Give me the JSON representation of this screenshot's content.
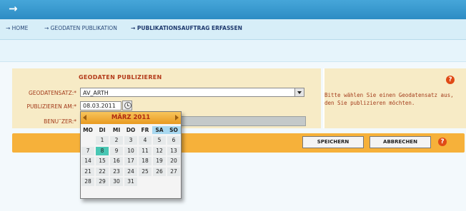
{
  "breadcrumb": [
    {
      "label": "HOME"
    },
    {
      "label": "GEODATEN PUBLIKATION"
    },
    {
      "label": "PUBLIKATIONSAUFTRAG ERFASSEN"
    }
  ],
  "form": {
    "title": "GEODATEN PUBLIZIEREN",
    "geodatensatz_label": "GEODATENSATZ:*",
    "geodatensatz_value": "AV_ARTH",
    "publish_date_label": "PUBLIZIEREN AM:*",
    "publish_date_value": "08.03.2011",
    "user_label": "BENU¯ZER:*",
    "user_value": ""
  },
  "hint": {
    "text": "Bitte wählen Sie einen Geodatensatz aus, den Sie publizieren möchten."
  },
  "actions": {
    "save_label": "SPEICHERN",
    "cancel_label": "ABBRECHEN"
  },
  "help_glyph": "?",
  "calendar": {
    "title": "MÄRZ 2011",
    "weekdays": [
      "MO",
      "DI",
      "MI",
      "DO",
      "FR",
      "SA",
      "SO"
    ],
    "days": [
      "1",
      "2",
      "3",
      "4",
      "5",
      "6",
      "7",
      "8",
      "9",
      "10",
      "11",
      "12",
      "13",
      "14",
      "15",
      "16",
      "17",
      "18",
      "19",
      "20",
      "21",
      "22",
      "23",
      "24",
      "25",
      "26",
      "27",
      "28",
      "29",
      "30",
      "31"
    ],
    "selected_day": "8"
  },
  "colors": {
    "accent_orange": "#f6b13a",
    "label_red": "#a33c1c",
    "today_teal": "#49c7b4",
    "topbar_blue": "#2d8cc4"
  },
  "icons": {
    "topbar": "arrow-right-icon",
    "dropdown": "chevron-down-icon",
    "clock": "clock-icon",
    "help": "help-icon"
  }
}
